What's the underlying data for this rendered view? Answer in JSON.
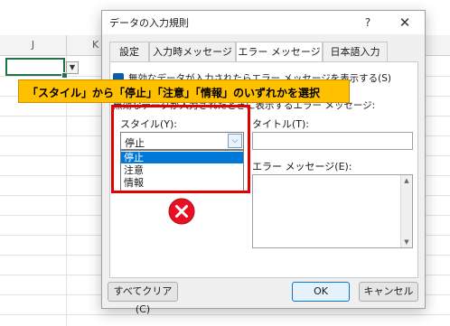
{
  "sheet": {
    "columns": [
      "J",
      "K"
    ]
  },
  "dialog": {
    "title": "データの入力規則",
    "help_label": "?",
    "close_label": "✕",
    "tabs": [
      {
        "label": "設定",
        "active": false
      },
      {
        "label": "入力時メッセージ",
        "active": false
      },
      {
        "label": "エラー メッセージ",
        "active": true
      },
      {
        "label": "日本語入力",
        "active": false
      }
    ],
    "checkbox_label": "無効なデータが入力されたらエラー メッセージを表示する(S)",
    "checkbox_checked": true,
    "sub_label": "無効なデータが入力されたときに表示するエラー メッセージ:",
    "style_label": "スタイル(Y):",
    "style_value": "停止",
    "style_options": [
      "停止",
      "注意",
      "情報"
    ],
    "style_selected_index": 0,
    "title_label": "タイトル(T):",
    "title_value": "",
    "message_label": "エラー メッセージ(E):",
    "message_value": "",
    "clear_all_label": "すべてクリア(C)",
    "ok_label": "OK",
    "cancel_label": "キャンセル",
    "icon": "error-x-icon",
    "accent_color": "#0078d7"
  },
  "callout": {
    "text": "「スタイル」から「停止」「注意」「情報」のいずれかを選択",
    "color": "#ffc000",
    "highlight_color": "#e00000"
  }
}
